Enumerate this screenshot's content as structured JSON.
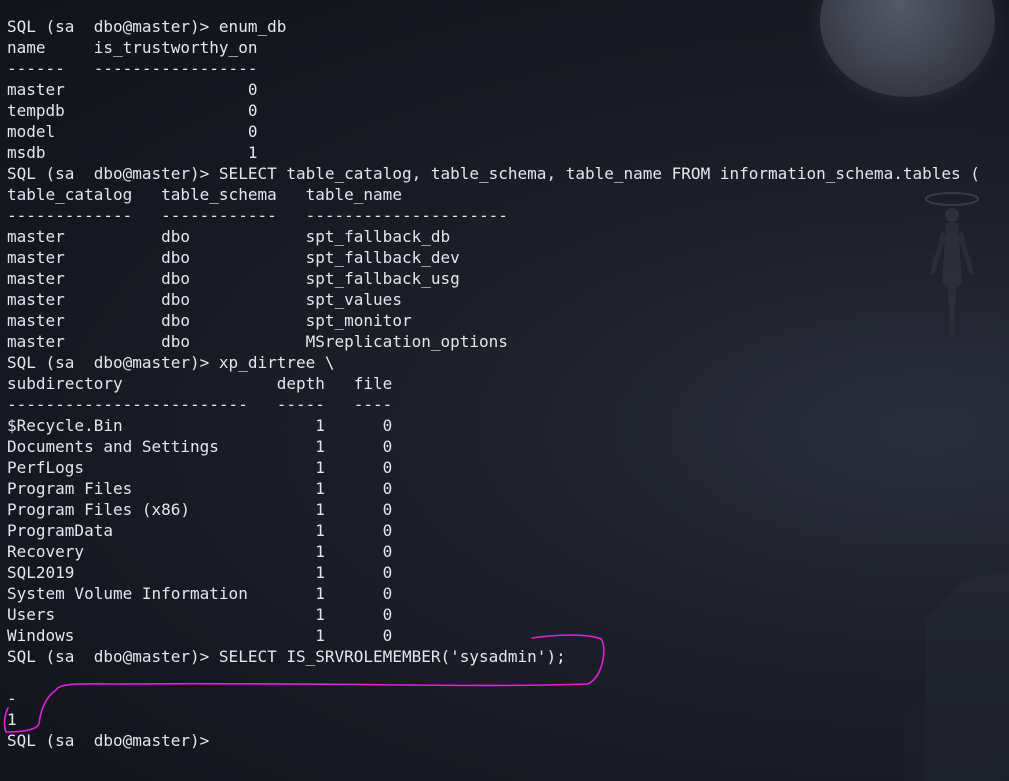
{
  "terminal": {
    "lines": [
      "SQL (sa  dbo@master)> enum_db",
      "name     is_trustworthy_on",
      "------   -----------------",
      "master                   0",
      "tempdb                   0",
      "model                    0",
      "msdb                     1",
      "SQL (sa  dbo@master)> SELECT table_catalog, table_schema, table_name FROM information_schema.tables (",
      "table_catalog   table_schema   table_name",
      "-------------   ------------   ---------------------",
      "master          dbo            spt_fallback_db",
      "master          dbo            spt_fallback_dev",
      "master          dbo            spt_fallback_usg",
      "master          dbo            spt_values",
      "master          dbo            spt_monitor",
      "master          dbo            MSreplication_options",
      "SQL (sa  dbo@master)> xp_dirtree \\",
      "subdirectory                depth   file",
      "-------------------------   -----   ----",
      "$Recycle.Bin                    1      0",
      "Documents and Settings          1      0",
      "PerfLogs                        1      0",
      "Program Files                   1      0",
      "Program Files (x86)             1      0",
      "ProgramData                     1      0",
      "Recovery                        1      0",
      "SQL2019                         1      0",
      "System Volume Information       1      0",
      "Users                           1      0",
      "Windows                         1      0",
      "SQL (sa  dbo@master)> SELECT IS_SRVROLEMEMBER('sysadmin');",
      "",
      "-",
      "1",
      "SQL (sa  dbo@master)> "
    ]
  },
  "colors": {
    "text": "#e4e6ec",
    "background": "#161821",
    "annotation": "#e020e0"
  },
  "icons": {
    "moon": "moon-wallpaper-icon",
    "figure": "floating-figure-icon",
    "ruin": "ruin-silhouette-icon"
  }
}
